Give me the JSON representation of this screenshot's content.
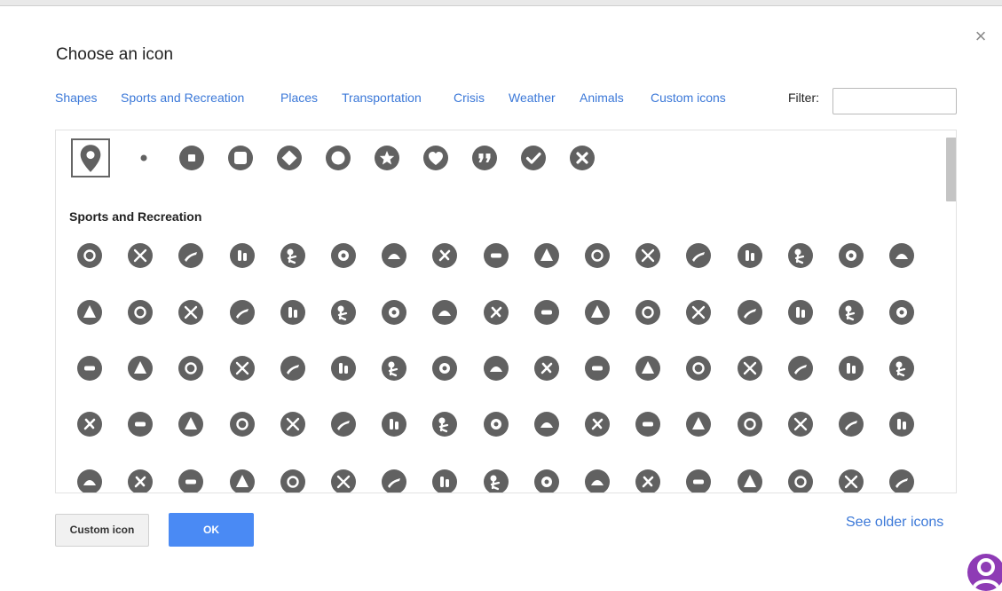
{
  "dialog": {
    "title": "Choose an icon",
    "close_glyph": "×",
    "tabs": [
      "Shapes",
      "Sports and Recreation",
      "Places",
      "Transportation",
      "Crisis",
      "Weather",
      "Animals",
      "Custom icons"
    ],
    "filter_label": "Filter:",
    "filter_value": "",
    "shapes_row": [
      "placemark-icon",
      "dot-icon",
      "circle-square-icon",
      "square-icon",
      "diamond-icon",
      "ring-icon",
      "star-icon",
      "heart-icon",
      "quote-icon",
      "checkmark-icon",
      "x-mark-icon"
    ],
    "selected_icon": "placemark-icon",
    "section_title": "Sports and Recreation",
    "sports_rows": [
      [
        "baseball-icon",
        "soccer-icon",
        "pingpong-icon",
        "golf-icon",
        "football-icon",
        "volleyball-icon",
        "tennis-icon",
        "golf-hole-icon",
        "magnifier-icon",
        "putting-icon",
        "trophy-icon",
        "basketball-icon",
        "bowling-icon",
        "boxing-glove-icon",
        "runner-icon",
        "crossed-swords-icon",
        "dumbbell-icon"
      ],
      [
        "checkered-flag-icon",
        "sports-fan-icon",
        "horse-icon",
        "bowling-ball-icon",
        "ball-icon",
        "hockey-icon",
        "arrow-target-icon",
        "running-icon",
        "hiking-icon",
        "cycling-icon",
        "martial-arts-icon",
        "lasso-icon",
        "goal-icon",
        "gymnast-icon",
        "ring-toss-icon",
        "skater-icon",
        "paragliding-icon"
      ],
      [
        "skier-icon",
        "hockey-sticks-icon",
        "skate-icon",
        "climbing-icon",
        "cross-country-icon",
        "rock-climbing-icon",
        "walker-icon",
        "sledding-icon",
        "trekking-icon",
        "jet-ski-icon",
        "kayak-icon",
        "rowing-icon",
        "sailing-icon",
        "boat-icon",
        "snowboard-icon",
        "wakeboard-icon",
        "surfing-icon"
      ],
      [
        "waves-icon",
        "scuba-icon",
        "swimmer-icon",
        "fish-icon",
        "water-ski-icon",
        "no-swimming-icon",
        "sliding-icon",
        "picnic-table-icon",
        "evergreen-icon",
        "tree-icon",
        "palm-tree-icon",
        "mountain-icon",
        "campfire-icon",
        "hot-spring-icon",
        "waterfall-icon",
        "star-icon",
        "hiker-icon"
      ],
      [
        "hiking-trail-icon",
        "family-walk-icon",
        "hunting-icon",
        "deer-icon",
        "bird-icon",
        "mountains-icon",
        "telescope-icon",
        "binoculars-icon",
        "tent-icon",
        "guitar-icon",
        "fire-icon",
        "grill-icon",
        "flashlight-icon",
        "rv-icon",
        "motorcycle-icon",
        "trailer-icon",
        "camper-icon"
      ]
    ],
    "buttons": {
      "custom_icon": "Custom icon",
      "ok": "OK"
    },
    "older_icons_link": "See older icons"
  },
  "colors": {
    "icon_fill": "#616161",
    "link": "#3b78d8",
    "ok_button": "#4a8af4",
    "avatar": "#8e3bb5"
  }
}
